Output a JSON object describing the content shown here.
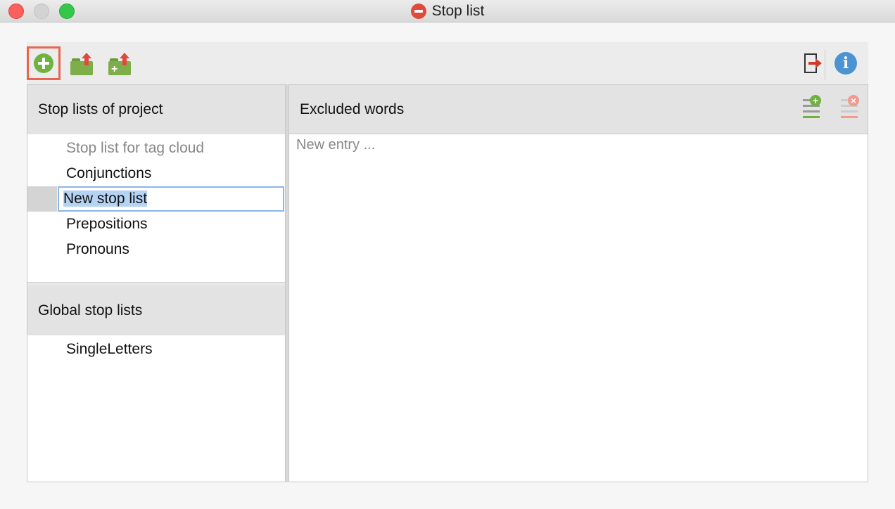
{
  "window": {
    "title": "Stop list"
  },
  "toolbar": {
    "buttons": [
      {
        "name": "new-stop-list",
        "icon": "plus-circle-icon",
        "color": "#6fb33f",
        "highlighted": true
      },
      {
        "name": "import-stop-list",
        "icon": "folder-upload-icon"
      },
      {
        "name": "import-append-stop-list",
        "icon": "folder-add-upload-icon"
      },
      {
        "name": "export",
        "icon": "exit-icon"
      },
      {
        "name": "info",
        "icon": "info-icon",
        "color": "#4b93d1"
      }
    ]
  },
  "left": {
    "project_header": "Stop lists of project",
    "project_items": [
      {
        "label": "Stop list for tag cloud",
        "dim": true
      },
      {
        "label": "Conjunctions"
      },
      {
        "label": "New stop list",
        "editing": true
      },
      {
        "label": "Prepositions"
      },
      {
        "label": "Pronouns"
      }
    ],
    "global_header": "Global stop lists",
    "global_items": [
      {
        "label": "SingleLetters"
      }
    ]
  },
  "right": {
    "header": "Excluded words",
    "new_entry_placeholder": "New entry ...",
    "add_word_icon": "add-word-icon",
    "remove_word_icon": "remove-word-icon"
  },
  "colors": {
    "highlight_border": "#e8654f",
    "selection": "#b5d3f3",
    "add_green": "#6fb33f",
    "remove_red": "#f19a8e"
  }
}
